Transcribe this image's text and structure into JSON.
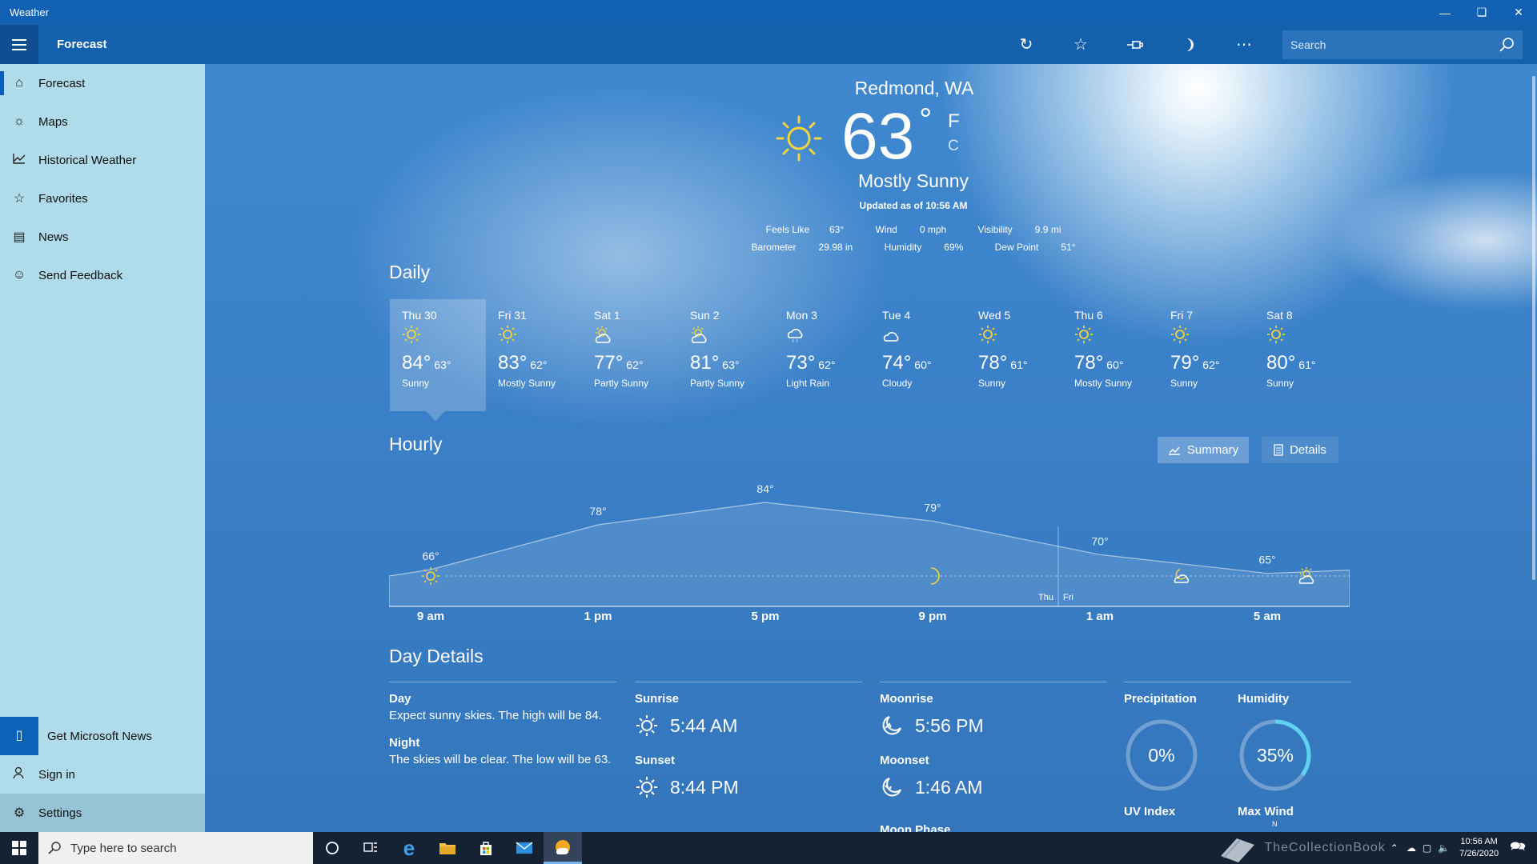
{
  "window": {
    "title": "Weather",
    "min_icon": "minimize-icon",
    "max_icon": "restore-icon",
    "close_icon": "close-icon"
  },
  "commandbar": {
    "title": "Forecast",
    "icons": [
      "refresh-icon",
      "favorite-star-icon",
      "pin-icon",
      "moon-theme-icon",
      "more-icon"
    ],
    "search_placeholder": "Search"
  },
  "sidebar": {
    "items": [
      {
        "label": "Forecast",
        "icon": "home-icon"
      },
      {
        "label": "Maps",
        "icon": "maps-icon"
      },
      {
        "label": "Historical Weather",
        "icon": "chart-icon"
      },
      {
        "label": "Favorites",
        "icon": "favorites-icon"
      },
      {
        "label": "News",
        "icon": "news-icon"
      },
      {
        "label": "Send Feedback",
        "icon": "smiley-icon"
      }
    ],
    "bottom": [
      {
        "label": "Get Microsoft News",
        "icon": "phone-icon"
      },
      {
        "label": "Sign in",
        "icon": "person-icon"
      },
      {
        "label": "Settings",
        "icon": "gear-icon"
      }
    ]
  },
  "current": {
    "location": "Redmond, WA",
    "temp": "63",
    "deg": "°",
    "unit_f": "F",
    "unit_c": "C",
    "condition": "Mostly Sunny",
    "updated": "Updated as of 10:56 AM",
    "stats_row1": [
      {
        "label": "Feels Like",
        "value": "63°"
      },
      {
        "label": "Wind",
        "value": "0 mph"
      },
      {
        "label": "Visibility",
        "value": "9.9 mi"
      }
    ],
    "stats_row2": [
      {
        "label": "Barometer",
        "value": "29.98 in"
      },
      {
        "label": "Humidity",
        "value": "69%"
      },
      {
        "label": "Dew Point",
        "value": "51°"
      }
    ]
  },
  "daily": {
    "title": "Daily",
    "days": [
      {
        "name": "Thu 30",
        "hi": "84°",
        "lo": "63°",
        "cond": "Sunny",
        "icon": "sun"
      },
      {
        "name": "Fri 31",
        "hi": "83°",
        "lo": "62°",
        "cond": "Mostly Sunny",
        "icon": "sun"
      },
      {
        "name": "Sat 1",
        "hi": "77°",
        "lo": "62°",
        "cond": "Partly Sunny",
        "icon": "partly"
      },
      {
        "name": "Sun 2",
        "hi": "81°",
        "lo": "63°",
        "cond": "Partly Sunny",
        "icon": "partly"
      },
      {
        "name": "Mon 3",
        "hi": "73°",
        "lo": "62°",
        "cond": "Light Rain",
        "icon": "rain"
      },
      {
        "name": "Tue 4",
        "hi": "74°",
        "lo": "60°",
        "cond": "Cloudy",
        "icon": "cloud"
      },
      {
        "name": "Wed 5",
        "hi": "78°",
        "lo": "61°",
        "cond": "Sunny",
        "icon": "sun"
      },
      {
        "name": "Thu 6",
        "hi": "78°",
        "lo": "60°",
        "cond": "Mostly Sunny",
        "icon": "sun"
      },
      {
        "name": "Fri 7",
        "hi": "79°",
        "lo": "62°",
        "cond": "Sunny",
        "icon": "sun"
      },
      {
        "name": "Sat 8",
        "hi": "80°",
        "lo": "61°",
        "cond": "Sunny",
        "icon": "sun"
      }
    ]
  },
  "hourly": {
    "title": "Hourly",
    "summary_label": "Summary",
    "details_label": "Details",
    "temps": [
      66,
      78,
      84,
      79,
      70,
      65
    ],
    "temp_labels": [
      "66°",
      "78°",
      "84°",
      "79°",
      "70°",
      "65°"
    ],
    "times": [
      "9 am",
      "1 pm",
      "5 pm",
      "9 pm",
      "1 am",
      "5 am"
    ],
    "day_split": {
      "before": "Thu",
      "after": "Fri"
    }
  },
  "day_details": {
    "title": "Day Details",
    "day_label": "Day",
    "day_text": "Expect sunny skies. The high will be 84.",
    "night_label": "Night",
    "night_text": "The skies will be clear. The low will be 63.",
    "sunrise_label": "Sunrise",
    "sunrise": "5:44 AM",
    "sunset_label": "Sunset",
    "sunset": "8:44 PM",
    "moonrise_label": "Moonrise",
    "moonrise": "5:56 PM",
    "moonset_label": "Moonset",
    "moonset": "1:46 AM",
    "moonphase_label": "Moon Phase",
    "precip_label": "Precipitation",
    "precip": "0%",
    "precip_value": 0,
    "humidity_label": "Humidity",
    "humidity": "35%",
    "humidity_value": 35,
    "uv_label": "UV Index",
    "wind_label": "Max Wind",
    "wind_dir": "N"
  },
  "taskbar": {
    "search_placeholder": "Type here to search",
    "watermark": "TheCollectionBook",
    "time": "10:56 AM",
    "date": "7/26/2020"
  },
  "colors": {
    "accent": "#1261b2",
    "sidebar": "#b0dbea",
    "sun": "#f5d33b",
    "ring": "#5fd2f0"
  }
}
